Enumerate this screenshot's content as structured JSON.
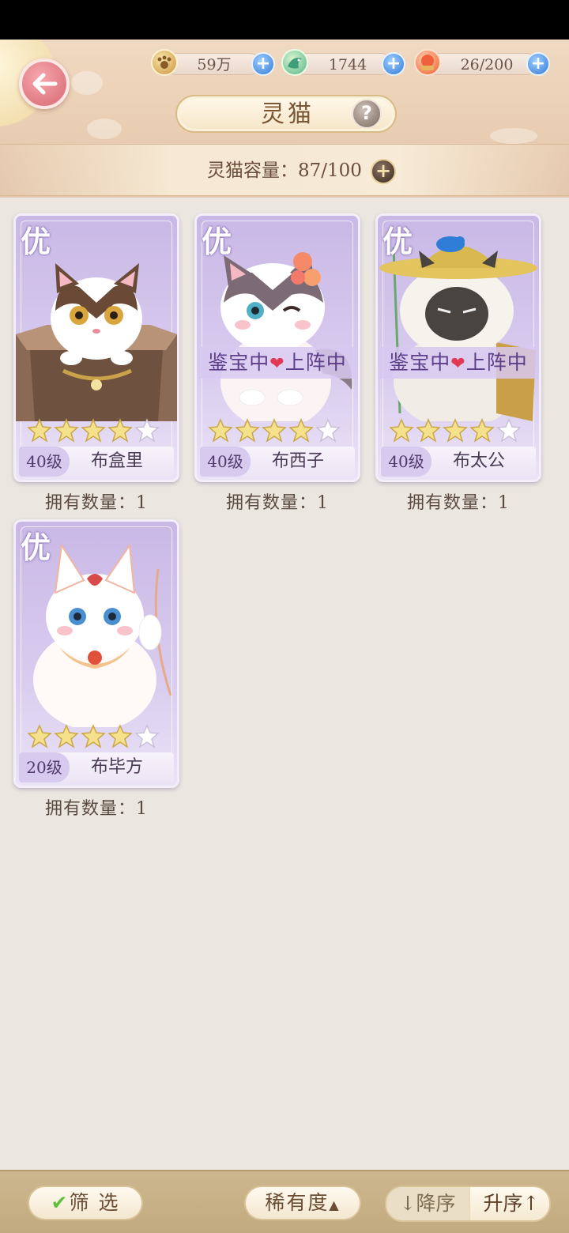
{
  "resources": [
    {
      "icon": "paw-coin-icon",
      "value": "59万"
    },
    {
      "icon": "jade-bird-icon",
      "value": "1744"
    },
    {
      "icon": "fish-food-icon",
      "value": "26/200"
    }
  ],
  "header": {
    "title": "灵猫",
    "help_symbol": "?"
  },
  "capacity": {
    "label": "灵猫容量：87/100"
  },
  "cards": [
    {
      "rarity": "优",
      "level": "40级",
      "name": "布盒里",
      "stars_lit": 4,
      "stars_total": 5,
      "status": "",
      "own": "拥有数量：1"
    },
    {
      "rarity": "优",
      "level": "40级",
      "name": "布西子",
      "stars_lit": 4,
      "stars_total": 5,
      "status_left": "鉴宝中",
      "status_right": "上阵中",
      "own": "拥有数量：1"
    },
    {
      "rarity": "优",
      "level": "40级",
      "name": "布太公",
      "stars_lit": 4,
      "stars_total": 5,
      "status_left": "鉴宝中",
      "status_right": "上阵中",
      "own": "拥有数量：1"
    },
    {
      "rarity": "优",
      "level": "20级",
      "name": "布毕方",
      "stars_lit": 4,
      "stars_total": 5,
      "status": "",
      "own": "拥有数量：1"
    }
  ],
  "bottom": {
    "filter_label": "筛 选",
    "rarity_sort_label": "稀有度",
    "desc_label": "↓降序",
    "asc_label": "升序↑"
  },
  "colors": {
    "card_purple": "#c9b8e6",
    "star_gold": "#f5e08c",
    "star_white": "#ffffff",
    "accent_pink": "#e07a83",
    "plus_blue": "#4d8fe0"
  }
}
